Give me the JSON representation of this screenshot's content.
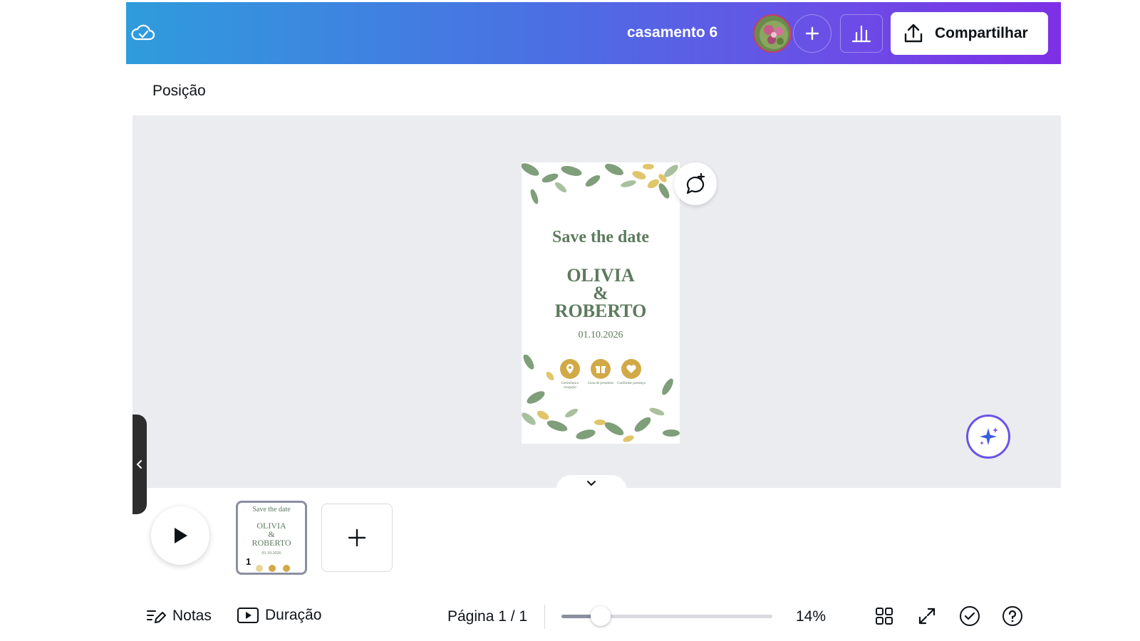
{
  "topbar": {
    "title": "casamento 6",
    "share_label": "Compartilhar",
    "gradient_colors": [
      "#2f9cdc",
      "#7e2fe6"
    ]
  },
  "toolbar": {
    "position_label": "Posição"
  },
  "design": {
    "heading": "Save the date",
    "name1": "OLIVIA",
    "ampersand": "&",
    "name2": "ROBERTO",
    "date": "01.10.2026",
    "icons": [
      {
        "icon": "location-pin-icon",
        "caption": "Cerimônia e recepção"
      },
      {
        "icon": "gift-icon",
        "caption": "Lista de presentes"
      },
      {
        "icon": "heart-icon",
        "caption": "Confirmar presença"
      }
    ],
    "accent": "#d2a946",
    "text_color": "#5d7a5d"
  },
  "thumbnail": {
    "heading": "Save the date",
    "name1": "OLIVIA",
    "ampersand": "&",
    "name2": "ROBERTO",
    "date": "01.10.2026",
    "page_number": "1"
  },
  "footer": {
    "notes_label": "Notas",
    "duration_label": "Duração",
    "page_indicator": "Página 1 / 1",
    "zoom_label": "14%",
    "zoom_fraction": 0.14
  }
}
